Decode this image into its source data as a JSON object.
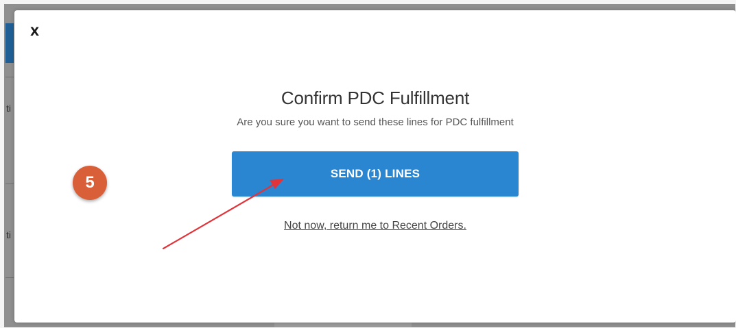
{
  "background": {
    "fragments": [
      "ti",
      "ti"
    ]
  },
  "modal": {
    "close_label": "X",
    "title": "Confirm PDC Fulfillment",
    "subtitle": "Are you sure you want to send these lines for PDC fulfillment",
    "primary_button_label": "SEND (1) LINES",
    "secondary_link_label": "Not now, return me to Recent Orders."
  },
  "annotation": {
    "step_number": "5",
    "step_color": "#d95f38",
    "arrow_color": "#e0343a"
  },
  "colors": {
    "primary_button": "#2a86d1",
    "backdrop": "#8f8f8f"
  }
}
